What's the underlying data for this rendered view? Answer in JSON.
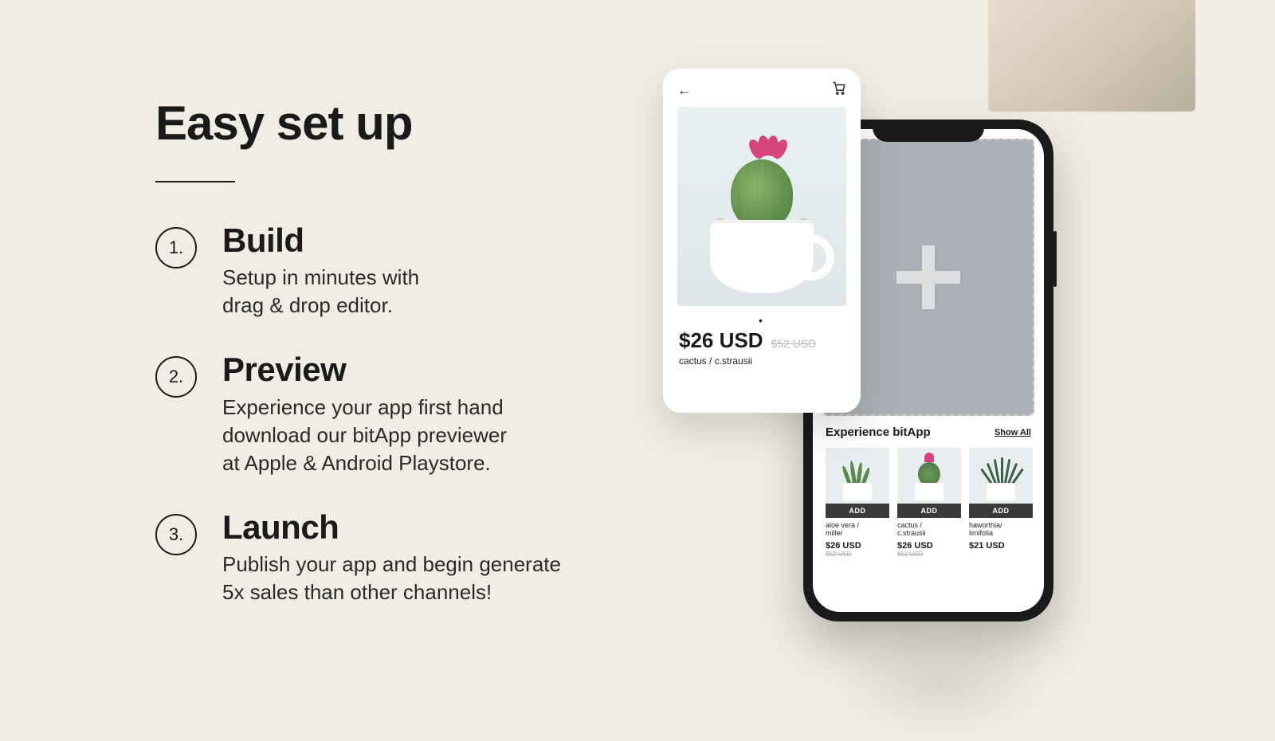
{
  "title": "Easy set up",
  "steps": [
    {
      "num": "1.",
      "title": "Build",
      "desc": "Setup in minutes with\ndrag & drop editor."
    },
    {
      "num": "2.",
      "title": "Preview",
      "desc": "Experience your app first hand\ndownload our bitApp previewer\nat Apple & Android Playstore."
    },
    {
      "num": "3.",
      "title": "Launch",
      "desc": "Publish your app and begin generate\n5x sales than other channels!"
    }
  ],
  "product_card": {
    "price": "$26 USD",
    "old_price": "$52 USD",
    "name": "cactus / c.strausii"
  },
  "phone_section": {
    "title": "Experience bitApp",
    "show_all": "Show All",
    "add_label": "ADD",
    "products": [
      {
        "name": "aloe vera /\nmiller",
        "price": "$26 USD",
        "old": "$52 USD"
      },
      {
        "name": "cactus /\nc.strausii",
        "price": "$26 USD",
        "old": "$52 USD"
      },
      {
        "name": "haworthia/\nlimifolia",
        "price": "$21 USD",
        "old": ""
      }
    ]
  }
}
